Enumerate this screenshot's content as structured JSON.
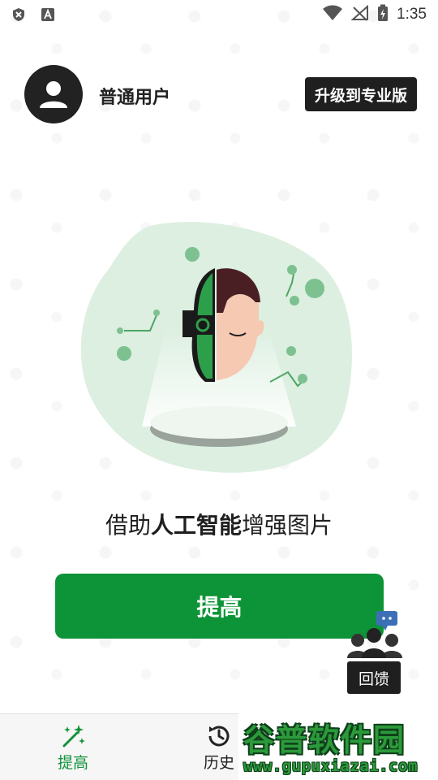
{
  "status_bar": {
    "time": "1:35",
    "left_icons": [
      "shield-x-icon",
      "font-a-icon"
    ],
    "right_icons": [
      "wifi-icon",
      "no-signal-icon",
      "battery-charging-icon"
    ]
  },
  "user": {
    "name": "普通用户",
    "upgrade_label": "升级到专业版"
  },
  "main": {
    "tagline_prefix": "借助",
    "tagline_bold": "人工智能",
    "tagline_suffix": "增强图片",
    "enhance_label": "提高"
  },
  "feedback": {
    "label": "回馈"
  },
  "bottom_nav": {
    "items": [
      {
        "label": "提高",
        "icon": "magic-sparkle-icon",
        "active": true
      },
      {
        "label": "历史",
        "icon": "history-icon",
        "active": false
      }
    ]
  },
  "brand_watermark": {
    "name": "谷普软件园",
    "url": "www.gupuxiazai.com"
  },
  "colors": {
    "accent": "#0e9438",
    "dark": "#1f1f1f",
    "blob": "#dcefe0"
  }
}
